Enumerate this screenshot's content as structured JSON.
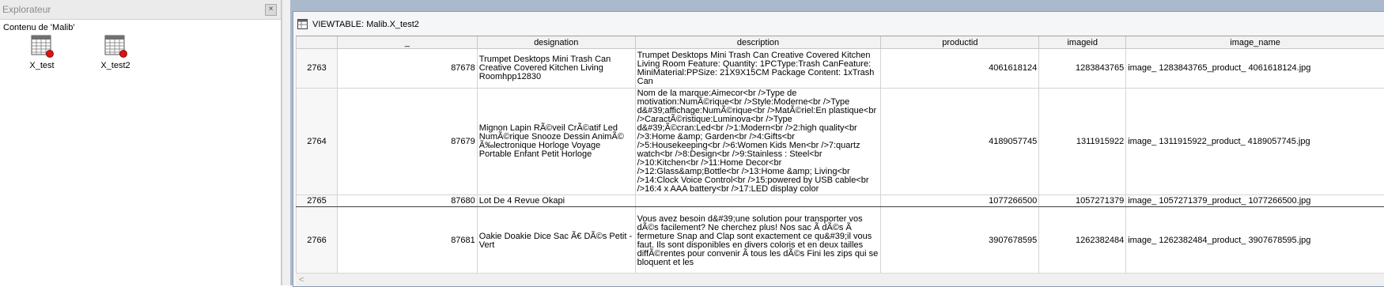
{
  "explorer": {
    "title": "Explorateur",
    "close_label": "×",
    "subtitle": "Contenu de 'Malib'",
    "items": [
      {
        "label": "X_test",
        "icon": "table-icon"
      },
      {
        "label": "X_test2",
        "icon": "table-icon"
      }
    ]
  },
  "viewtable": {
    "title": "VIEWTABLE: Malib.X_test2",
    "columns": [
      "_",
      "designation",
      "description",
      "productid",
      "imageid",
      "image_name"
    ],
    "rows": [
      {
        "row": "2763",
        "id": "87678",
        "designation": "Trumpet Desktops Mini Trash Can Creative Covered Kitchen Living Roomhpp12830",
        "description": "Trumpet Desktops Mini Trash Can Creative Covered Kitchen Living Room Feature: Quantity: 1PCType:Trash CanFeature: MiniMaterial:PPSize: 21X9X15CM Package Content: 1xTrash Can",
        "productid": "4061618124",
        "imageid": "1283843765",
        "image_name": "image_  1283843765_product_  4061618124.jpg"
      },
      {
        "row": "2764",
        "id": "87679",
        "designation": "Mignon Lapin RÃ©veil CrÃ©atif Led NumÃ©rique Snooze Dessin AnimÃ© Ã‰lectronique Horloge Voyage Portable Enfant Petit Horloge",
        "description": "Nom de la marque:Aimecor<br />Type de motivation:NumÃ©rique<br />Style:Moderne<br />Type d&#39;affichage:NumÃ©rique<br />MatÃ©riel:En plastique<br />CaractÃ©ristique:Luminova<br />Type d&#39;Ã©cran:Led<br />1:Modern<br />2:high quality<br />3:Home &amp; Garden<br />4:Gifts<br />5:Housekeeping<br />6:Women Kids Men<br />7:quartz watch<br />8:Design<br />9:Stainless : Steel<br />10:Kitchen<br />11:Home Decor<br />12:Glass&amp;Bottle<br />13:Home &amp; Living<br />14:Clock Voice Control<br />15:powered by USB cable<br />16:4 x AAA battery<br />17:LED display color",
        "productid": "4189057745",
        "imageid": "1311915922",
        "image_name": "image_  1311915922_product_  4189057745.jpg"
      },
      {
        "row": "2765",
        "id": "87680",
        "designation": "Lot De 4 Revue Okapi",
        "description": "",
        "productid": "1077266500",
        "imageid": "1057271379",
        "image_name": "image_  1057271379_product_  1077266500.jpg"
      },
      {
        "row": "2766",
        "id": "87681",
        "designation": "Oakie Doakie Dice Sac Ã€ DÃ©s Petit - Vert",
        "description": "Vous avez besoin d&#39;une solution pour transporter vos dÃ©s facilement? Ne cherchez plus! Nos sac Ã  dÃ©s Ã  fermeture Snap and Clap sont exactement ce qu&#39;il vous faut. Ils sont disponibles en divers coloris et en deux tailles diffÃ©rentes pour convenir Ã  tous les dÃ©s Fini les zips qui se bloquent et les",
        "productid": "3907678595",
        "imageid": "1262382484",
        "image_name": "image_  1262382484_product_  3907678595.jpg"
      }
    ],
    "scroll_left": "<"
  },
  "colors": {
    "mdi_background": "#abb9cc",
    "explorer_title": "#8a8a8a",
    "table_icon_dot": "#e01010"
  }
}
